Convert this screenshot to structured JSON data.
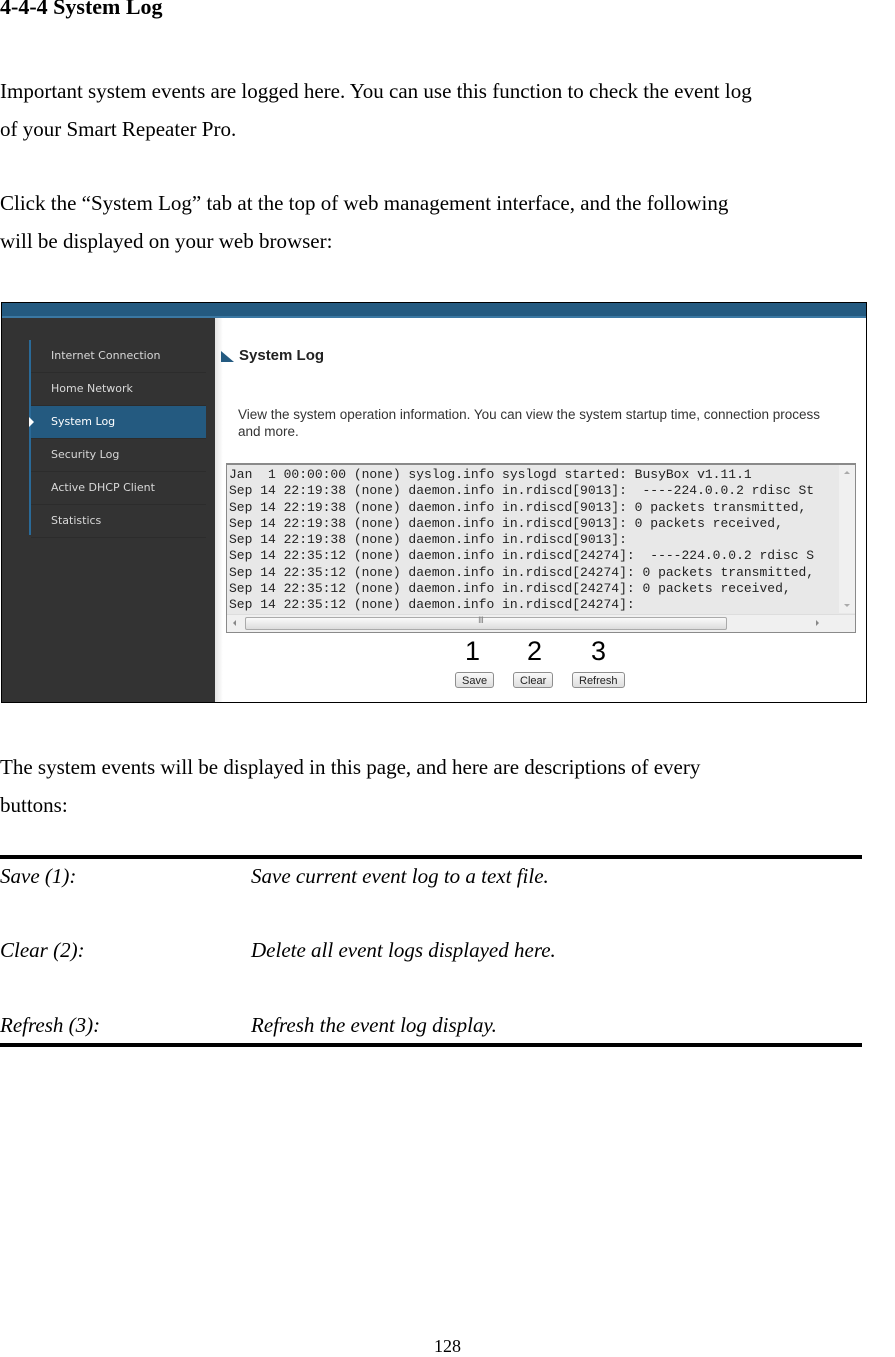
{
  "heading": "4-4-4 System Log",
  "intro_paragraph": [
    "Important system events are logged here. You can use this function to check the event log",
    "of your Smart Repeater Pro."
  ],
  "instruction_paragraph": [
    "Click the “System Log” tab at the top of web management interface, and the following",
    "will be displayed on your web browser:"
  ],
  "screenshot": {
    "colors": {
      "accent": "#245a80",
      "sidebar_bg": "#333333",
      "log_bg": "#e8e8e8"
    },
    "sidebar": {
      "items": [
        {
          "label": "Internet Connection",
          "active": false
        },
        {
          "label": "Home Network",
          "active": false
        },
        {
          "label": "System Log",
          "active": true
        },
        {
          "label": "Security Log",
          "active": false
        },
        {
          "label": "Active DHCP Client",
          "active": false
        },
        {
          "label": "Statistics",
          "active": false
        }
      ]
    },
    "main": {
      "title": "System Log",
      "description": "View the system operation information. You can view the system startup time, connection process and more.",
      "log_lines": [
        "Jan  1 00:00:00 (none) syslog.info syslogd started: BusyBox v1.11.1",
        "Sep 14 22:19:38 (none) daemon.info in.rdiscd[9013]:  ----224.0.0.2 rdisc St",
        "Sep 14 22:19:38 (none) daemon.info in.rdiscd[9013]: 0 packets transmitted,",
        "Sep 14 22:19:38 (none) daemon.info in.rdiscd[9013]: 0 packets received,",
        "Sep 14 22:19:38 (none) daemon.info in.rdiscd[9013]:",
        "Sep 14 22:35:12 (none) daemon.info in.rdiscd[24274]:  ----224.0.0.2 rdisc S",
        "Sep 14 22:35:12 (none) daemon.info in.rdiscd[24274]: 0 packets transmitted,",
        "Sep 14 22:35:12 (none) daemon.info in.rdiscd[24274]: 0 packets received,",
        "Sep 14 22:35:12 (none) daemon.info in.rdiscd[24274]:"
      ],
      "scroll_grip": "III",
      "callouts": [
        "1",
        "2",
        "3"
      ],
      "buttons": {
        "save": "Save",
        "clear": "Clear",
        "refresh": "Refresh"
      }
    }
  },
  "buttons_paragraph": [
    "The system events will be displayed in this page, and here are descriptions of every",
    "buttons:"
  ],
  "descriptions": [
    {
      "label": "Save (1):",
      "text": "Save current event log to a text file."
    },
    {
      "label": "Clear (2):",
      "text": "Delete all event logs displayed here."
    },
    {
      "label": "Refresh (3):",
      "text": "Refresh the event log display."
    }
  ],
  "page_number": "128"
}
